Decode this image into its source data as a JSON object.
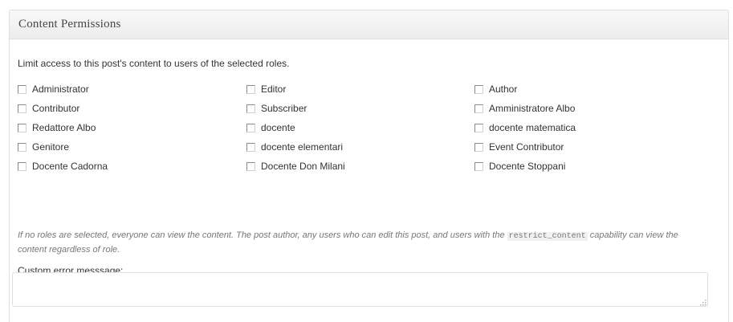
{
  "metabox": {
    "title": "Content Permissions"
  },
  "intro_text": "Limit access to this post's content to users of the selected roles.",
  "roles": [
    {
      "label": "Administrator",
      "checked": false
    },
    {
      "label": "Editor",
      "checked": false
    },
    {
      "label": "Author",
      "checked": false
    },
    {
      "label": "Contributor",
      "checked": false
    },
    {
      "label": "Subscriber",
      "checked": false
    },
    {
      "label": "Amministratore Albo",
      "checked": false
    },
    {
      "label": "Redattore Albo",
      "checked": false
    },
    {
      "label": "docente",
      "checked": false
    },
    {
      "label": "docente matematica",
      "checked": false
    },
    {
      "label": "Genitore",
      "checked": false
    },
    {
      "label": "docente elementari",
      "checked": false
    },
    {
      "label": "Event Contributor",
      "checked": false
    },
    {
      "label": "Docente Cadorna",
      "checked": false
    },
    {
      "label": "Docente Don Milani",
      "checked": false
    },
    {
      "label": "Docente Stoppani",
      "checked": false
    }
  ],
  "note": {
    "part1": "If no roles are selected, everyone can view the content. The post author, any users who can edit this post, and users with the",
    "capability": "restrict_content",
    "part2": "capability can view the content regardless of role."
  },
  "error_message": {
    "label": "Custom error messsage:",
    "value": ""
  }
}
